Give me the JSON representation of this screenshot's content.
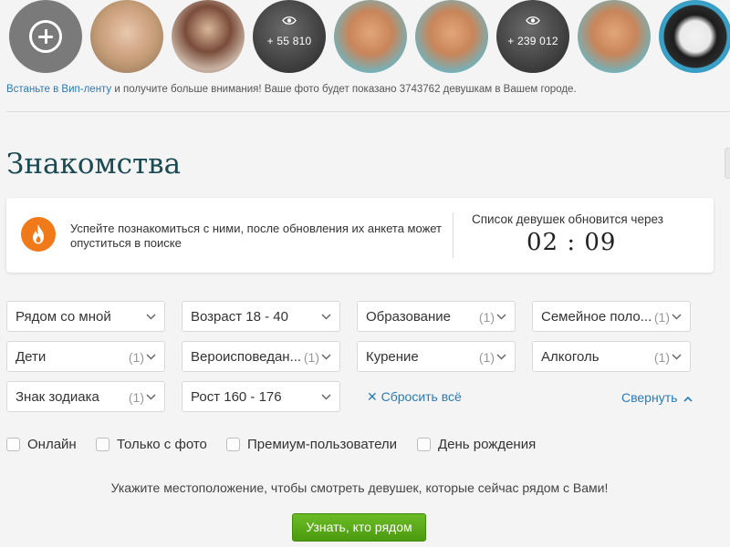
{
  "strip": {
    "count_a": "+ 55 810",
    "count_b": "+ 239 012"
  },
  "vip": {
    "link": "Встаньте в Вип-ленту",
    "text": " и получите больше внимания! Ваше фото будет показано 3743762 девушкам в Вашем городе."
  },
  "page": {
    "title": "Знакомства"
  },
  "notice": {
    "text": "Успейте познакомиться с ними, после обновления их анкета может опуститься в поиске",
    "timer_label": "Список девушек обновится через",
    "timer_value": "02 : 09"
  },
  "filters": [
    {
      "label": "Рядом со мной",
      "count": ""
    },
    {
      "label": "Возраст 18 - 40",
      "count": ""
    },
    {
      "label": "Образование",
      "count": "(1)"
    },
    {
      "label": "Семейное поло...",
      "count": "(1)"
    },
    {
      "label": "Дети",
      "count": "(1)"
    },
    {
      "label": "Вероисповедан...",
      "count": "(1)"
    },
    {
      "label": "Курение",
      "count": "(1)"
    },
    {
      "label": "Алкоголь",
      "count": "(1)"
    },
    {
      "label": "Знак зодиака",
      "count": "(1)"
    },
    {
      "label": "Рост 160 - 176",
      "count": ""
    }
  ],
  "actions": {
    "reset": "Сбросить всё",
    "collapse": "Свернуть"
  },
  "checks": [
    {
      "label": "Онлайн"
    },
    {
      "label": "Только с фото"
    },
    {
      "label": "Премиум-пользователи"
    },
    {
      "label": "День рождения"
    }
  ],
  "geo": {
    "text": "Укажите местоположение, чтобы смотреть девушек, которые сейчас рядом с Вами!",
    "button": "Узнать, кто рядом"
  },
  "colors": {
    "link": "#2a7ab8",
    "title": "#1b4a52",
    "accent_orange": "#f07a1a",
    "button_green": "#5aa91a"
  }
}
